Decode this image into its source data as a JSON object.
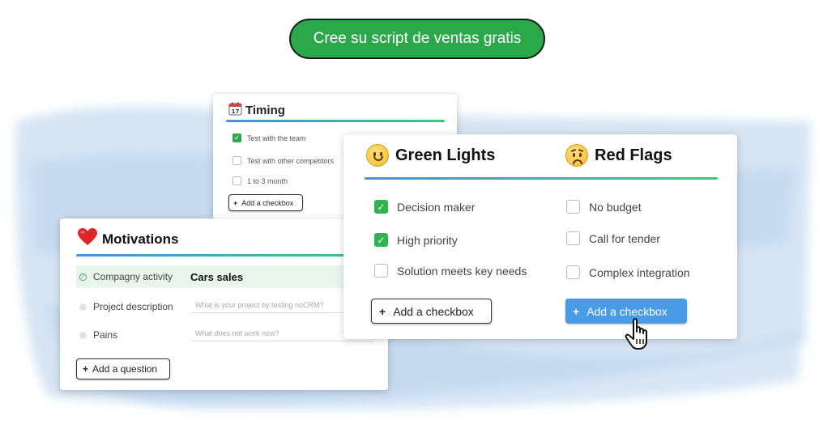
{
  "cta": {
    "label": "Cree su script de ventas gratis"
  },
  "timing": {
    "icon": "calendar-icon",
    "title": "Timing",
    "items": [
      {
        "label": "Test with the team",
        "checked": true
      },
      {
        "label": "Test with other competitors",
        "checked": false
      },
      {
        "label": "1 to 3 month",
        "checked": false
      }
    ],
    "add_button": "Add a checkbox"
  },
  "motivations": {
    "icon": "heart-icon",
    "title": "Motivations",
    "rows": [
      {
        "label": "Compagny activity",
        "value": "Cars sales",
        "status": "done"
      },
      {
        "label": "Project description",
        "placeholder": "What is your project by testing noCRM?",
        "status": "empty"
      },
      {
        "label": "Pains",
        "placeholder": "What does not work now?",
        "status": "empty"
      }
    ],
    "add_button": "Add a question"
  },
  "green_lights": {
    "icon": "smiling-face-icon",
    "title": "Green Lights",
    "items": [
      {
        "label": "Decision maker",
        "checked": true
      },
      {
        "label": "High priority",
        "checked": true
      },
      {
        "label": "Solution meets key needs",
        "checked": false
      }
    ],
    "add_button": "Add a checkbox"
  },
  "red_flags": {
    "icon": "worried-face-icon",
    "title": "Red Flags",
    "items": [
      {
        "label": "No budget",
        "checked": false
      },
      {
        "label": "Call for tender",
        "checked": false
      },
      {
        "label": "Complex integration",
        "checked": false
      }
    ],
    "add_button": "Add a checkbox"
  },
  "colors": {
    "accent_green": "#2aa84a",
    "accent_blue": "#4a9be6"
  }
}
